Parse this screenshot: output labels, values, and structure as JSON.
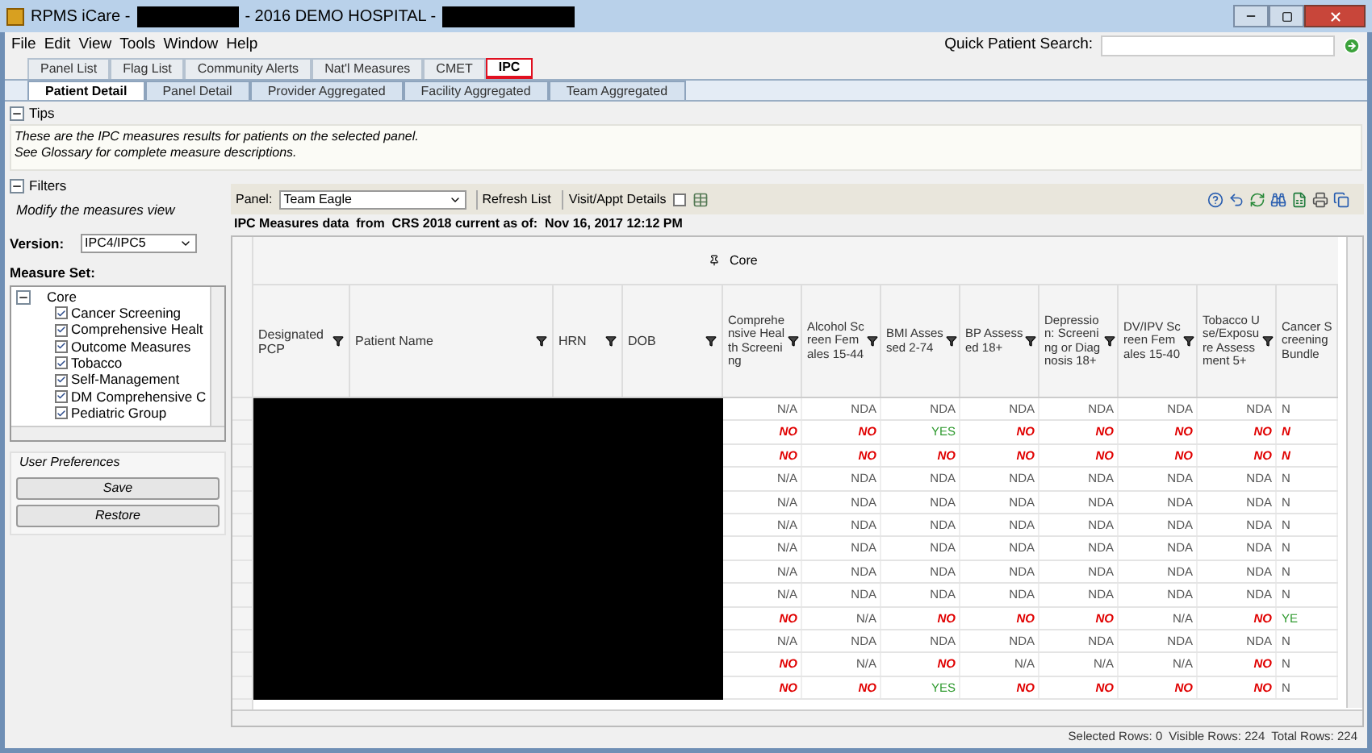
{
  "window": {
    "title_prefix": "RPMS iCare -",
    "title_middle": "- 2016 DEMO HOSPITAL -"
  },
  "menu": [
    "File",
    "Edit",
    "View",
    "Tools",
    "Window",
    "Help"
  ],
  "quick_search": {
    "label": "Quick Patient Search:"
  },
  "main_tabs": [
    {
      "label": "Panel List",
      "selected": false,
      "highlighted": false
    },
    {
      "label": "Flag List",
      "selected": false,
      "highlighted": false
    },
    {
      "label": "Community Alerts",
      "selected": false,
      "highlighted": false
    },
    {
      "label": "Nat'l Measures",
      "selected": false,
      "highlighted": false
    },
    {
      "label": "CMET",
      "selected": false,
      "highlighted": false
    },
    {
      "label": "IPC",
      "selected": true,
      "highlighted": true
    }
  ],
  "sub_tabs": [
    {
      "label": "Patient Detail",
      "selected": true
    },
    {
      "label": "Panel Detail",
      "selected": false
    },
    {
      "label": "Provider Aggregated",
      "selected": false
    },
    {
      "label": "Facility Aggregated",
      "selected": false
    },
    {
      "label": "Team Aggregated",
      "selected": false
    }
  ],
  "tips": {
    "title": "Tips",
    "expanded": true,
    "lines": [
      "These are the IPC measures results for patients on the selected panel.",
      "See Glossary for complete measure descriptions."
    ]
  },
  "filters": {
    "title": "Filters",
    "expanded": true,
    "hint": "Modify the measures view",
    "version_label": "Version:",
    "version": "IPC4/IPC5",
    "measure_set_label": "Measure Set:",
    "tree": [
      {
        "label": "Core",
        "expanded": true,
        "children": [
          {
            "label": "Cancer Screening",
            "checked": true
          },
          {
            "label": "Comprehensive Healt",
            "checked": true
          },
          {
            "label": "Outcome Measures",
            "checked": true
          },
          {
            "label": "Tobacco",
            "checked": true
          },
          {
            "label": "Self-Management",
            "checked": true
          },
          {
            "label": "DM Comprehensive C",
            "checked": true
          },
          {
            "label": "Pediatric Group",
            "checked": true
          }
        ]
      }
    ],
    "preferences_title": "User Preferences",
    "buttons": [
      "Save",
      "Restore"
    ]
  },
  "toolbar": {
    "panel_label": "Panel:",
    "panel": "Team Eagle",
    "refresh": "Refresh List",
    "visit_label": "Visit/Appt Details",
    "visit_checked": false
  },
  "data_caption": "IPC Measures data  from  CRS 2018 current as of:  Nov 16, 2017 12:12 PM",
  "grid": {
    "group": "Core",
    "fixed_columns": [
      "Designated PCP",
      "Patient Name",
      "HRN",
      "DOB"
    ],
    "columns": [
      "Comprehensive Health Screening",
      "Alcohol Screen Females 15-44",
      "BMI Assessed 2-74",
      "BP Assessed 18+",
      "Depression: Screening or Diagnosis 18+",
      "DV/IPV Screen Females 15-40",
      "Tobacco Use/Exposure Assessment 5+",
      "Cancer Screening Bundle"
    ],
    "rows": [
      [
        {
          "text": "N/A",
          "kind": "na"
        },
        {
          "text": "NDA",
          "kind": "na"
        },
        {
          "text": "NDA",
          "kind": "na"
        },
        {
          "text": "NDA",
          "kind": "na"
        },
        {
          "text": "NDA",
          "kind": "na"
        },
        {
          "text": "NDA",
          "kind": "na"
        },
        {
          "text": "NDA",
          "kind": "na"
        },
        {
          "text": "N",
          "kind": "na"
        }
      ],
      [
        {
          "text": "NO",
          "kind": "no"
        },
        {
          "text": "NO",
          "kind": "no"
        },
        {
          "text": "YES",
          "kind": "yes"
        },
        {
          "text": "NO",
          "kind": "no"
        },
        {
          "text": "NO",
          "kind": "no"
        },
        {
          "text": "NO",
          "kind": "no"
        },
        {
          "text": "NO",
          "kind": "no"
        },
        {
          "text": "N",
          "kind": "no"
        }
      ],
      [
        {
          "text": "NO",
          "kind": "no"
        },
        {
          "text": "NO",
          "kind": "no"
        },
        {
          "text": "NO",
          "kind": "no"
        },
        {
          "text": "NO",
          "kind": "no"
        },
        {
          "text": "NO",
          "kind": "no"
        },
        {
          "text": "NO",
          "kind": "no"
        },
        {
          "text": "NO",
          "kind": "no"
        },
        {
          "text": "N",
          "kind": "no"
        }
      ],
      [
        {
          "text": "N/A",
          "kind": "na"
        },
        {
          "text": "NDA",
          "kind": "na"
        },
        {
          "text": "NDA",
          "kind": "na"
        },
        {
          "text": "NDA",
          "kind": "na"
        },
        {
          "text": "NDA",
          "kind": "na"
        },
        {
          "text": "NDA",
          "kind": "na"
        },
        {
          "text": "NDA",
          "kind": "na"
        },
        {
          "text": "N",
          "kind": "na"
        }
      ],
      [
        {
          "text": "N/A",
          "kind": "na"
        },
        {
          "text": "NDA",
          "kind": "na"
        },
        {
          "text": "NDA",
          "kind": "na"
        },
        {
          "text": "NDA",
          "kind": "na"
        },
        {
          "text": "NDA",
          "kind": "na"
        },
        {
          "text": "NDA",
          "kind": "na"
        },
        {
          "text": "NDA",
          "kind": "na"
        },
        {
          "text": "N",
          "kind": "na"
        }
      ],
      [
        {
          "text": "N/A",
          "kind": "na"
        },
        {
          "text": "NDA",
          "kind": "na"
        },
        {
          "text": "NDA",
          "kind": "na"
        },
        {
          "text": "NDA",
          "kind": "na"
        },
        {
          "text": "NDA",
          "kind": "na"
        },
        {
          "text": "NDA",
          "kind": "na"
        },
        {
          "text": "NDA",
          "kind": "na"
        },
        {
          "text": "N",
          "kind": "na"
        }
      ],
      [
        {
          "text": "N/A",
          "kind": "na"
        },
        {
          "text": "NDA",
          "kind": "na"
        },
        {
          "text": "NDA",
          "kind": "na"
        },
        {
          "text": "NDA",
          "kind": "na"
        },
        {
          "text": "NDA",
          "kind": "na"
        },
        {
          "text": "NDA",
          "kind": "na"
        },
        {
          "text": "NDA",
          "kind": "na"
        },
        {
          "text": "N",
          "kind": "na"
        }
      ],
      [
        {
          "text": "N/A",
          "kind": "na"
        },
        {
          "text": "NDA",
          "kind": "na"
        },
        {
          "text": "NDA",
          "kind": "na"
        },
        {
          "text": "NDA",
          "kind": "na"
        },
        {
          "text": "NDA",
          "kind": "na"
        },
        {
          "text": "NDA",
          "kind": "na"
        },
        {
          "text": "NDA",
          "kind": "na"
        },
        {
          "text": "N",
          "kind": "na"
        }
      ],
      [
        {
          "text": "N/A",
          "kind": "na"
        },
        {
          "text": "NDA",
          "kind": "na"
        },
        {
          "text": "NDA",
          "kind": "na"
        },
        {
          "text": "NDA",
          "kind": "na"
        },
        {
          "text": "NDA",
          "kind": "na"
        },
        {
          "text": "NDA",
          "kind": "na"
        },
        {
          "text": "NDA",
          "kind": "na"
        },
        {
          "text": "N",
          "kind": "na"
        }
      ],
      [
        {
          "text": "NO",
          "kind": "no"
        },
        {
          "text": "N/A",
          "kind": "na"
        },
        {
          "text": "NO",
          "kind": "no"
        },
        {
          "text": "NO",
          "kind": "no"
        },
        {
          "text": "NO",
          "kind": "no"
        },
        {
          "text": "N/A",
          "kind": "na"
        },
        {
          "text": "NO",
          "kind": "no"
        },
        {
          "text": "YE",
          "kind": "yes"
        }
      ],
      [
        {
          "text": "N/A",
          "kind": "na"
        },
        {
          "text": "NDA",
          "kind": "na"
        },
        {
          "text": "NDA",
          "kind": "na"
        },
        {
          "text": "NDA",
          "kind": "na"
        },
        {
          "text": "NDA",
          "kind": "na"
        },
        {
          "text": "NDA",
          "kind": "na"
        },
        {
          "text": "NDA",
          "kind": "na"
        },
        {
          "text": "N",
          "kind": "na"
        }
      ],
      [
        {
          "text": "NO",
          "kind": "no"
        },
        {
          "text": "N/A",
          "kind": "na"
        },
        {
          "text": "NO",
          "kind": "no"
        },
        {
          "text": "N/A",
          "kind": "na"
        },
        {
          "text": "N/A",
          "kind": "na"
        },
        {
          "text": "N/A",
          "kind": "na"
        },
        {
          "text": "NO",
          "kind": "no"
        },
        {
          "text": "N",
          "kind": "na"
        }
      ],
      [
        {
          "text": "NO",
          "kind": "no"
        },
        {
          "text": "NO",
          "kind": "no"
        },
        {
          "text": "YES",
          "kind": "yes"
        },
        {
          "text": "NO",
          "kind": "no"
        },
        {
          "text": "NO",
          "kind": "no"
        },
        {
          "text": "NO",
          "kind": "no"
        },
        {
          "text": "NO",
          "kind": "no"
        },
        {
          "text": "N",
          "kind": "na"
        }
      ]
    ]
  },
  "status": [
    "Selected Rows: 0",
    "Visible Rows: 224",
    "Total Rows: 224"
  ]
}
